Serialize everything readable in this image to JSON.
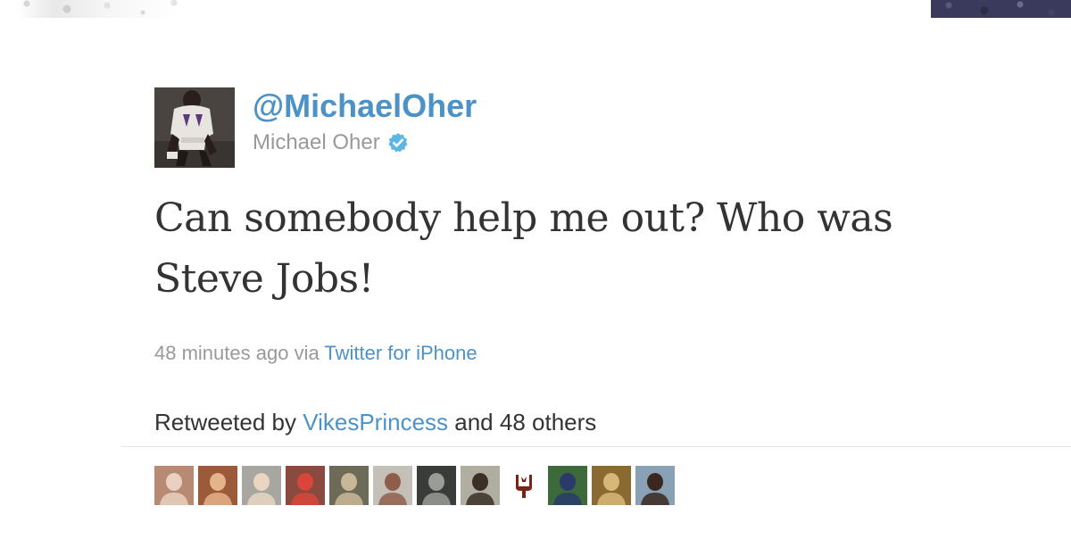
{
  "tweet": {
    "handle": "@MichaelOher",
    "full_name": "Michael Oher",
    "verified": true,
    "text": "Can somebody help me out? Who was Steve Jobs!",
    "timestamp": "48 minutes ago",
    "via_prefix": "via",
    "source": "Twitter for iPhone",
    "retweet": {
      "prefix": "Retweeted by",
      "user": "VikesPrincess",
      "suffix": "and 48 others"
    }
  },
  "icons": {
    "verified": "verified-badge-icon"
  },
  "colors": {
    "link": "#4d92c7",
    "muted": "#999999",
    "text": "#333333",
    "verified_badge": "#5db5e8"
  },
  "retweeters": [
    {
      "name": "retweeter-avatar-1",
      "bg": "#b88a74",
      "fg": "#e9d0c0"
    },
    {
      "name": "retweeter-avatar-2",
      "bg": "#9b5a3a",
      "fg": "#e5b38a"
    },
    {
      "name": "retweeter-avatar-3",
      "bg": "#a8a6a0",
      "fg": "#e8d6c2"
    },
    {
      "name": "retweeter-avatar-4",
      "bg": "#8a4a40",
      "fg": "#d8453a"
    },
    {
      "name": "retweeter-avatar-5",
      "bg": "#6d6a58",
      "fg": "#c9b896"
    },
    {
      "name": "retweeter-avatar-6",
      "bg": "#c4c0b8",
      "fg": "#8f5e4a"
    },
    {
      "name": "retweeter-avatar-7",
      "bg": "#3a3c3a",
      "fg": "#9a9c96"
    },
    {
      "name": "retweeter-avatar-8",
      "bg": "#b0aea0",
      "fg": "#3a3028"
    },
    {
      "name": "retweeter-avatar-9",
      "bg": "#ffffff",
      "fg": "#7a2418",
      "logo": true
    },
    {
      "name": "retweeter-avatar-10",
      "bg": "#3c6a3a",
      "fg": "#2a3a6a"
    },
    {
      "name": "retweeter-avatar-11",
      "bg": "#8a6a30",
      "fg": "#d8b878"
    },
    {
      "name": "retweeter-avatar-12",
      "bg": "#8aa0b4",
      "fg": "#3a2820"
    }
  ]
}
